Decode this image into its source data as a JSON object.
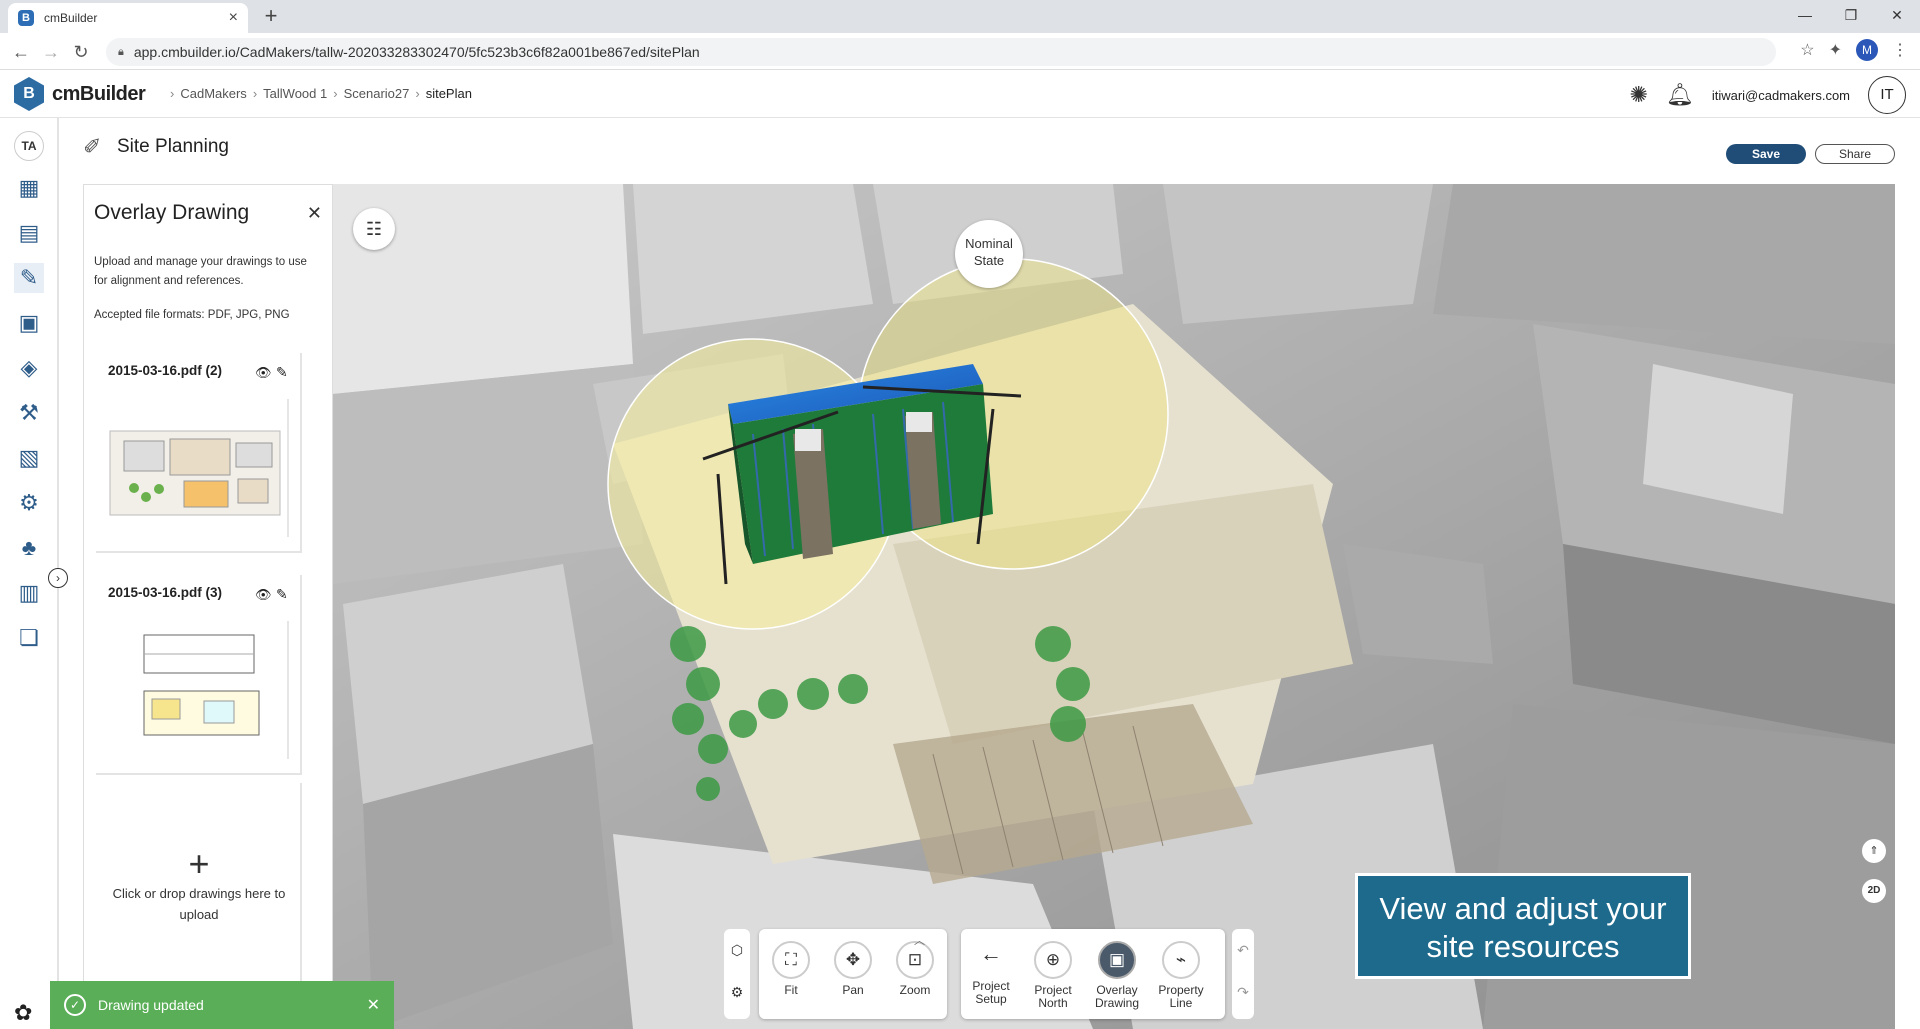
{
  "browser": {
    "tab_title": "cmBuilder",
    "url": "app.cmbuilder.io/CadMakers/tallw-202033283302470/5fc523b3c6f82a001be867ed/sitePlan",
    "profile_initial": "M"
  },
  "header": {
    "brand": "cmBuilder",
    "breadcrumbs": [
      "CadMakers",
      "TallWood 1",
      "Scenario27",
      "sitePlan"
    ],
    "email": "itiwari@cadmakers.com",
    "user_initials": "IT"
  },
  "rail": {
    "user_initials": "TA"
  },
  "page": {
    "title": "Site Planning",
    "save_label": "Save",
    "share_label": "Share"
  },
  "panel": {
    "title": "Overlay Drawing",
    "description": "Upload and manage your drawings to use for alignment and references.",
    "formats": "Accepted file formats: PDF, JPG, PNG",
    "drawings": [
      {
        "name": "2015-03-16.pdf (2)"
      },
      {
        "name": "2015-03-16.pdf (3)"
      }
    ],
    "upload_text": "Click or drop drawings here to upload"
  },
  "map": {
    "state_label": "Nominal State",
    "promo_text": "View and adjust your site resources",
    "twod_label": "2D"
  },
  "toolbar": {
    "fit": "Fit",
    "pan": "Pan",
    "zoom": "Zoom",
    "project_setup": "Project Setup",
    "project_north": "Project North",
    "overlay_drawing": "Overlay Drawing",
    "property_line": "Property Line"
  },
  "toast": {
    "message": "Drawing updated"
  },
  "colors": {
    "brand": "#2d6ca3",
    "save_button": "#1f4d78",
    "toast": "#5aae57",
    "promo": "#1d6a8c"
  }
}
